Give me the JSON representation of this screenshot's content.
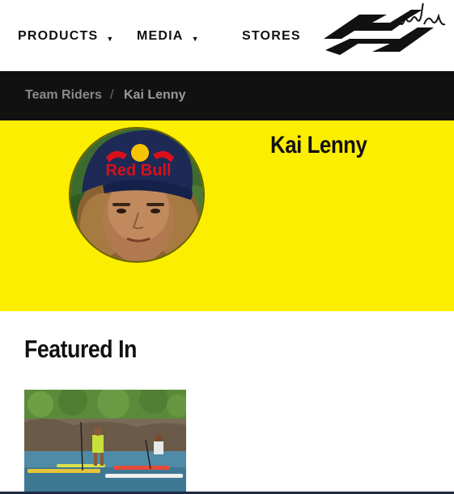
{
  "nav": {
    "products": "PRODUCTS",
    "media": "MEDIA",
    "stores": "STORES",
    "caret": "▼"
  },
  "brand": {
    "name": "naish"
  },
  "breadcrumb": {
    "items": [
      "Team Riders",
      "Kai Lenny"
    ],
    "separator": "/"
  },
  "rider": {
    "name": "Kai Lenny",
    "cap_text": "Red Bull"
  },
  "featured": {
    "title": "Featured In"
  },
  "colors": {
    "accent": "#fcee00",
    "dark_bar": "#111111",
    "text": "#111111"
  }
}
